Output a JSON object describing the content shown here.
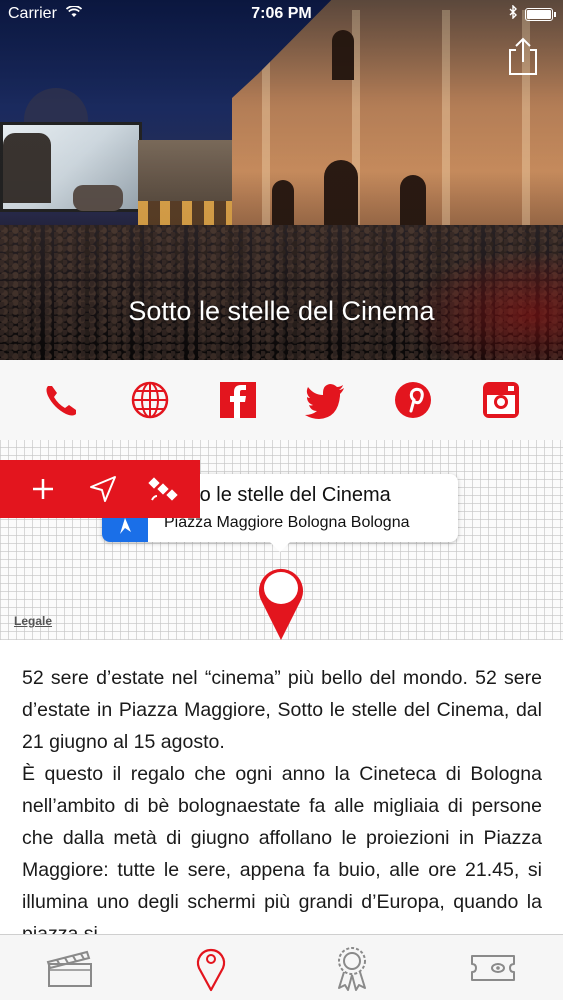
{
  "status_bar": {
    "carrier": "Carrier",
    "time": "7:06 PM"
  },
  "hero": {
    "title": "Sotto le stelle del Cinema"
  },
  "contact_icons": [
    "phone-icon",
    "globe-icon",
    "facebook-icon",
    "twitter-icon",
    "pinterest-icon",
    "instagram-icon"
  ],
  "map": {
    "callout_title": "Sotto le stelle del Cinema",
    "callout_subtitle": "Piazza Maggiore Bologna Bologna",
    "legal_link": "Legale",
    "toolbar_icons": [
      "plus-icon",
      "navigate-arrow-icon",
      "satellite-icon"
    ]
  },
  "description": {
    "paragraphs": [
      "52 sere d’estate nel “cinema” più bello del mondo. 52 sere d’estate in Piazza Maggiore, Sotto le stelle del Cinema, dal 21 giugno al 15 agosto.",
      "È questo il regalo che ogni anno la Cineteca di Bologna nell’ambito di bè bolognaestate fa alle migliaia di persone che dalla metà di giugno affollano le proiezioni in Piazza Maggiore: tutte le sere, appena fa buio, alle ore 21.45, si illumina uno degli schermi più grandi d’Europa, quando la piazza si"
    ]
  },
  "tab_bar": {
    "tabs": [
      "clapperboard-icon",
      "map-pin-icon",
      "award-ribbon-icon",
      "ticket-icon"
    ],
    "active_index": 1
  },
  "colors": {
    "accent": "#e3151e",
    "tab_inactive": "#8a8a8a"
  }
}
